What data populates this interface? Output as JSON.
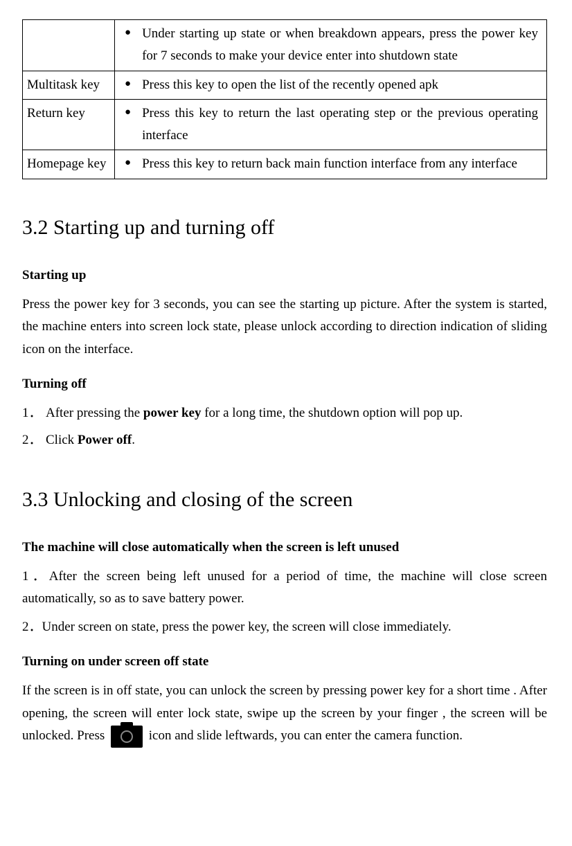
{
  "table": {
    "rows": [
      {
        "label": "",
        "text": "Under starting up state or when breakdown appears, press the power key for 7 seconds to make your device enter into shutdown state"
      },
      {
        "label": "Multitask key",
        "text": "Press this key to open the list of the recently opened apk"
      },
      {
        "label": "Return key",
        "text": "Press this key to return the last operating step or the previous operating interface"
      },
      {
        "label": "Homepage key",
        "text": "Press this key to return back main function interface from any interface"
      }
    ]
  },
  "sec32": {
    "heading": "3.2 Starting up and turning off",
    "startHead": "Starting up",
    "startBody": "Press the power key for 3 seconds, you can see the starting up picture. After the system is started, the machine enters into screen lock state, please unlock according to direction indication of sliding icon on the interface.",
    "offHead": "Turning off",
    "step1_pre": "After pressing the ",
    "step1_bold": "power key",
    "step1_post": " for a long time, the shutdown option will pop up.",
    "step2_pre": "Click ",
    "step2_bold": "Power off",
    "step2_post": "."
  },
  "sec33": {
    "heading": "3.3 Unlocking and closing of the screen",
    "autoHead": "The machine will close automatically when the screen is left unused",
    "auto1": "After the screen being left unused for a period of time, the machine will close screen automatically, so as to save battery power.",
    "auto2": "Under screen on state, press the power key, the screen will close immediately.",
    "onHead": "Turning on under screen off state",
    "onBody_pre": "If the screen is in off state, you can unlock the screen by pressing power key for a short time . After opening, the screen will enter lock state, swipe up the screen by your finger , the screen will be unlocked. Press ",
    "onBody_post": " icon and slide leftwards, you can enter the camera function."
  },
  "nums": {
    "n1": "1．",
    "n2": "2．",
    "d1": "1．",
    "d2": "2．"
  }
}
